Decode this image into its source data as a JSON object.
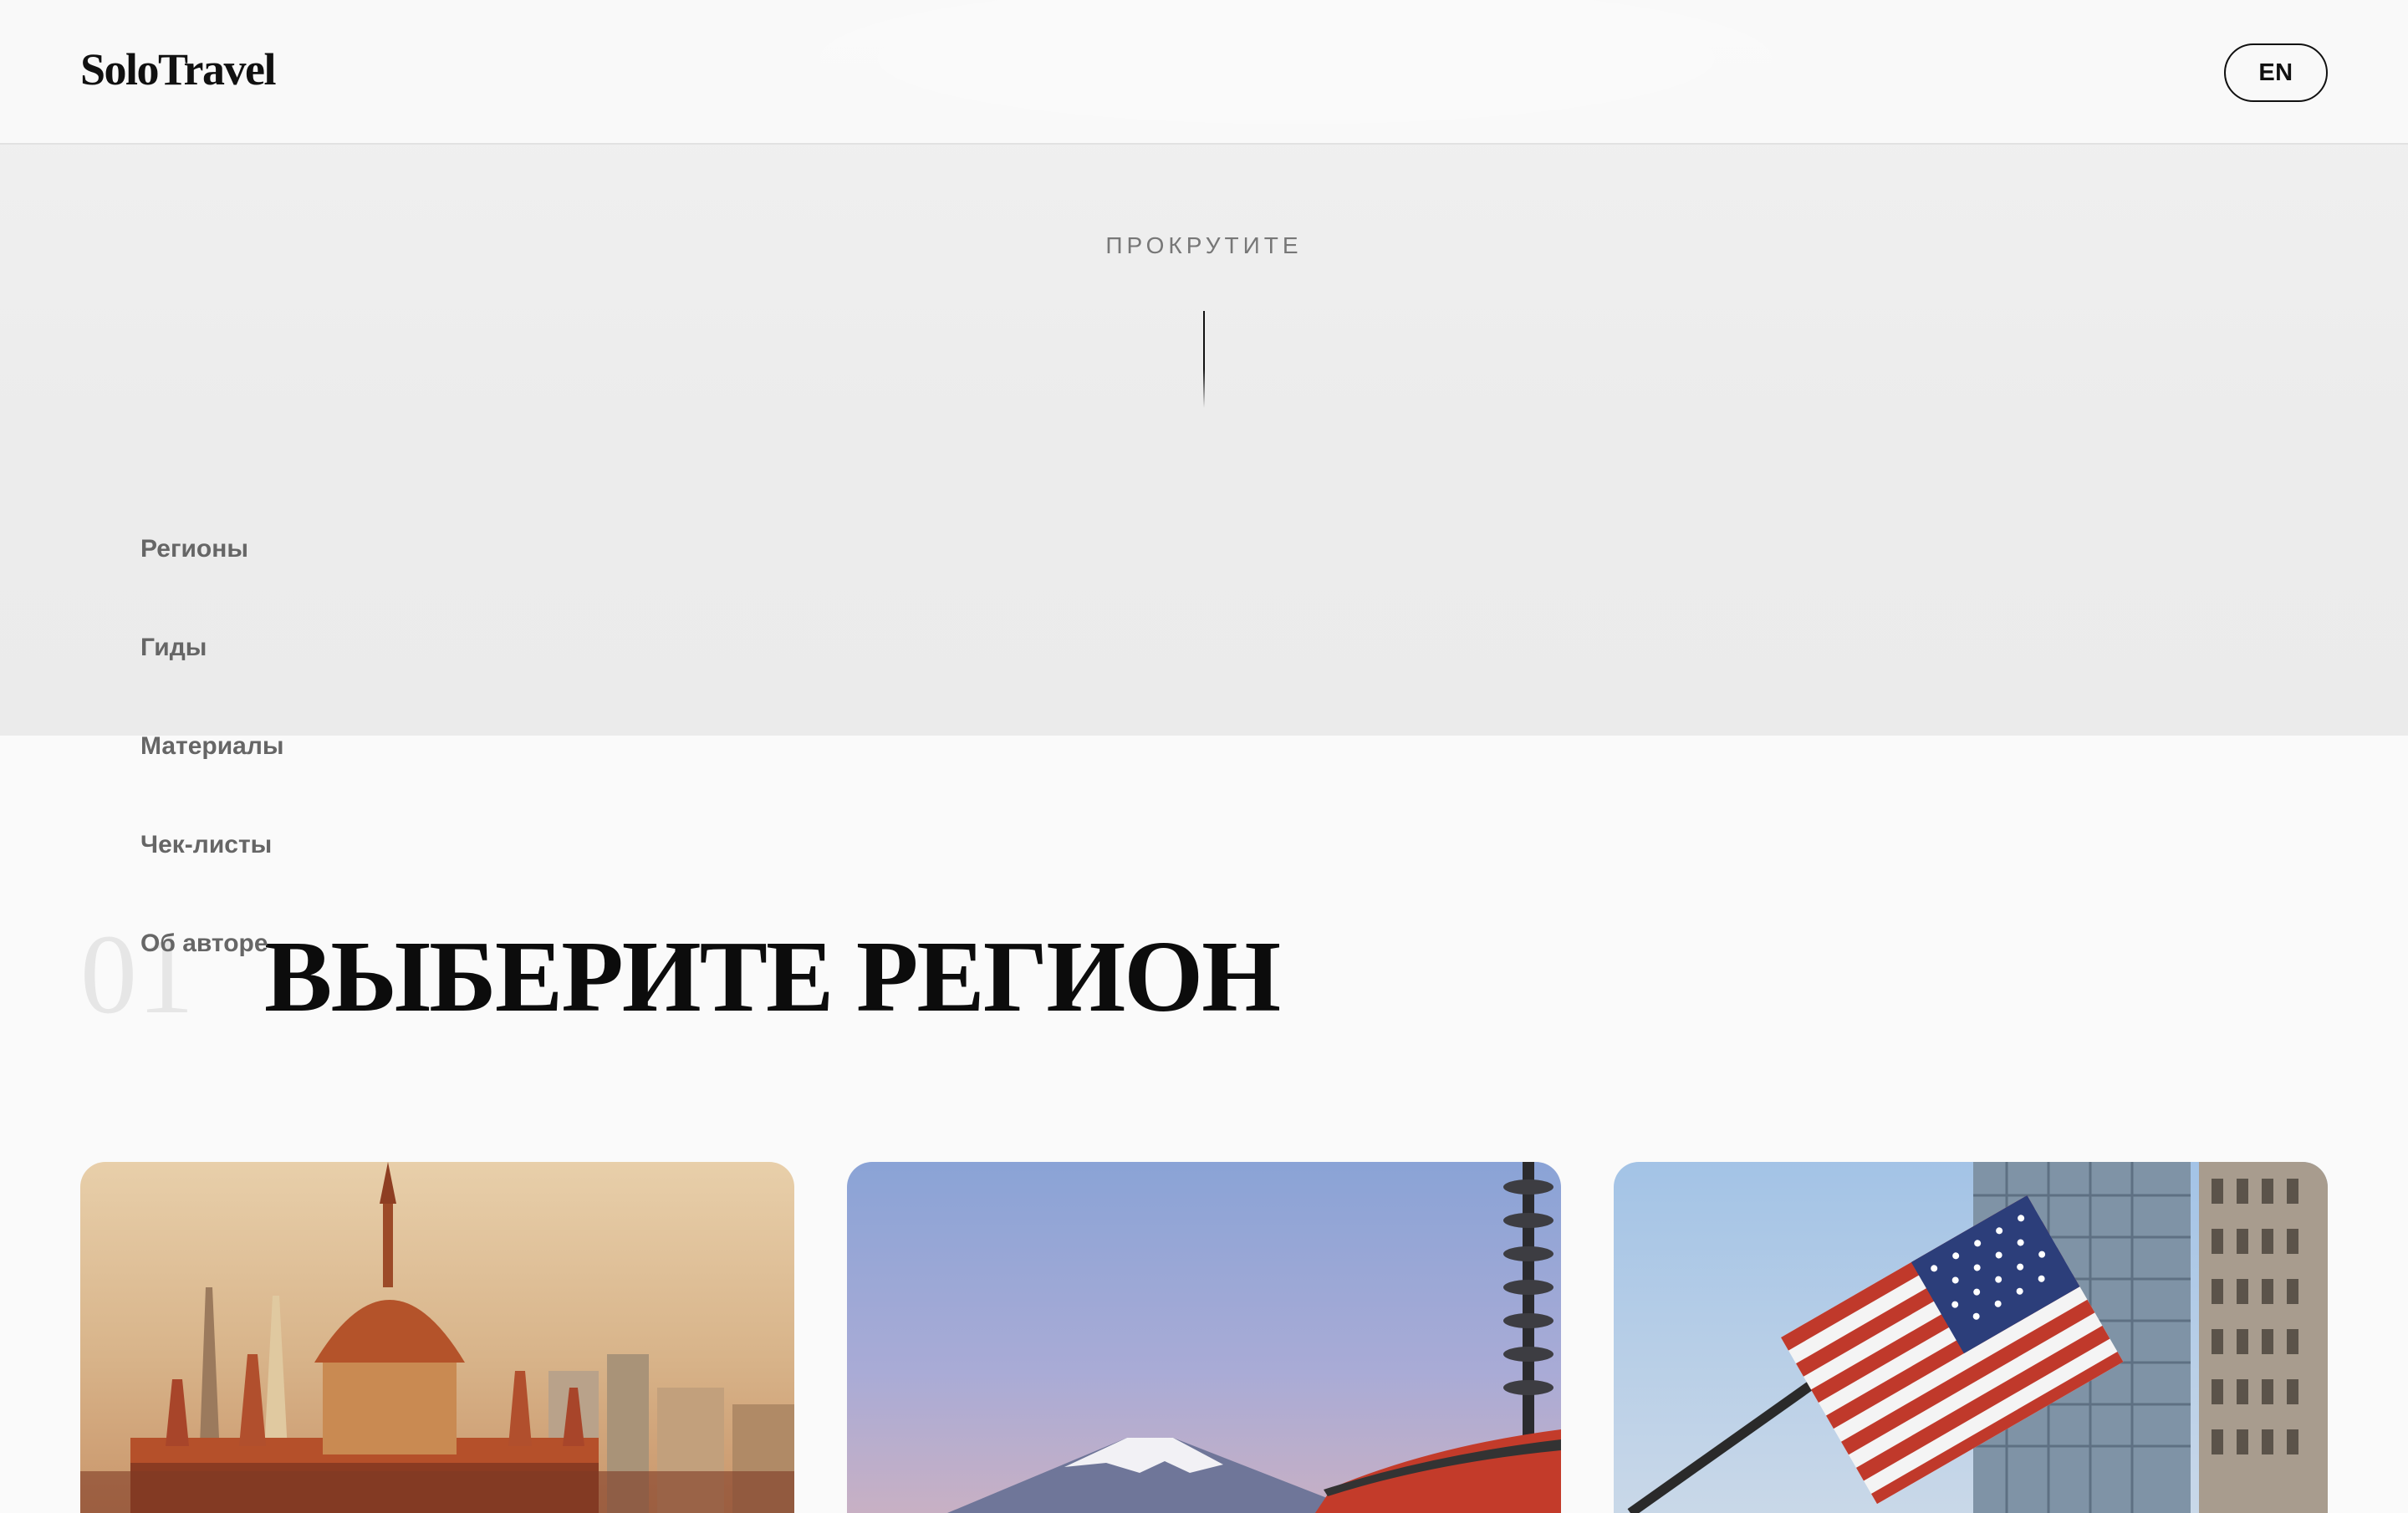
{
  "header": {
    "logo": "SoloTravel",
    "lang_button": "EN"
  },
  "hero": {
    "scroll_label": "ПРОКРУТИТЕ"
  },
  "nav": {
    "items": [
      {
        "label": "Регионы"
      },
      {
        "label": "Гиды"
      },
      {
        "label": "Материалы"
      },
      {
        "label": "Чек-листы"
      },
      {
        "label": "Об авторе"
      }
    ]
  },
  "section": {
    "number": "01",
    "title": "ВЫБЕРИТЕ РЕГИОН"
  },
  "cards": [
    {
      "image": "budapest-parliament"
    },
    {
      "image": "mount-fuji-pagoda"
    },
    {
      "image": "usa-flag-skyscrapers"
    }
  ],
  "colors": {
    "page_bg": "#fafafa",
    "text": "#111111",
    "muted": "#666666",
    "number_ghost": "#e6e6e6"
  }
}
